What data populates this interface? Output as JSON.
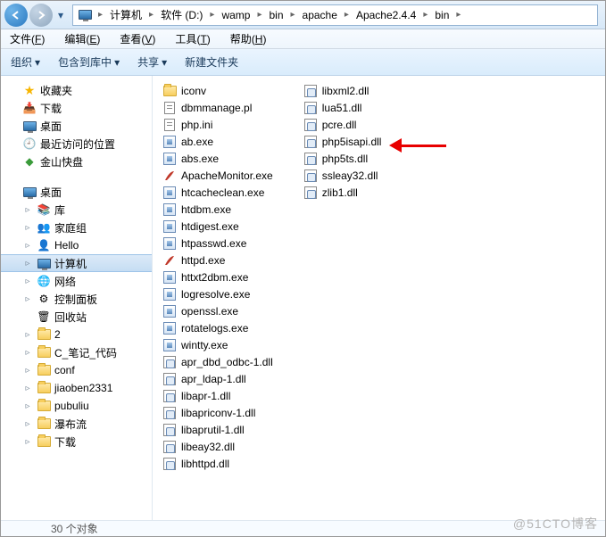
{
  "breadcrumb": {
    "items": [
      "计算机",
      "软件 (D:)",
      "wamp",
      "bin",
      "apache",
      "Apache2.4.4",
      "bin"
    ]
  },
  "menus": {
    "file": "文件",
    "fk": "F",
    "edit": "编辑",
    "ek": "E",
    "view": "查看",
    "vk": "V",
    "tools": "工具",
    "tk": "T",
    "help": "帮助",
    "hk": "H"
  },
  "toolbar": {
    "organize": "组织",
    "include": "包含到库中",
    "share": "共享",
    "newfolder": "新建文件夹"
  },
  "sidebar": {
    "fav": "收藏夹",
    "fav_items": [
      "下载",
      "桌面",
      "最近访问的位置",
      "金山快盘"
    ],
    "desktop": "桌面",
    "desktop_items": [
      "库",
      "家庭组",
      "Hello",
      "计算机",
      "网络",
      "控制面板",
      "回收站",
      "2",
      "C_笔记_代码",
      "conf",
      "jiaoben2331",
      "pubuliu",
      "瀑布流",
      "下载"
    ]
  },
  "files_col1": [
    {
      "n": "iconv",
      "t": "folder"
    },
    {
      "n": "dbmmanage.pl",
      "t": "ini"
    },
    {
      "n": "php.ini",
      "t": "ini"
    },
    {
      "n": "ab.exe",
      "t": "exe"
    },
    {
      "n": "abs.exe",
      "t": "exe"
    },
    {
      "n": "ApacheMonitor.exe",
      "t": "feather"
    },
    {
      "n": "htcacheclean.exe",
      "t": "exe"
    },
    {
      "n": "htdbm.exe",
      "t": "exe"
    },
    {
      "n": "htdigest.exe",
      "t": "exe"
    },
    {
      "n": "htpasswd.exe",
      "t": "exe"
    },
    {
      "n": "httpd.exe",
      "t": "feather"
    },
    {
      "n": "httxt2dbm.exe",
      "t": "exe"
    },
    {
      "n": "logresolve.exe",
      "t": "exe"
    },
    {
      "n": "openssl.exe",
      "t": "exe"
    },
    {
      "n": "rotatelogs.exe",
      "t": "exe"
    },
    {
      "n": "wintty.exe",
      "t": "exe"
    },
    {
      "n": "apr_dbd_odbc-1.dll",
      "t": "dll"
    },
    {
      "n": "apr_ldap-1.dll",
      "t": "dll"
    },
    {
      "n": "libapr-1.dll",
      "t": "dll"
    },
    {
      "n": "libapriconv-1.dll",
      "t": "dll"
    },
    {
      "n": "libaprutil-1.dll",
      "t": "dll"
    },
    {
      "n": "libeay32.dll",
      "t": "dll"
    },
    {
      "n": "libhttpd.dll",
      "t": "dll"
    }
  ],
  "files_col2": [
    {
      "n": "libxml2.dll",
      "t": "dll"
    },
    {
      "n": "lua51.dll",
      "t": "dll"
    },
    {
      "n": "pcre.dll",
      "t": "dll"
    },
    {
      "n": "php5isapi.dll",
      "t": "dll"
    },
    {
      "n": "php5ts.dll",
      "t": "dll"
    },
    {
      "n": "ssleay32.dll",
      "t": "dll"
    },
    {
      "n": "zlib1.dll",
      "t": "dll"
    }
  ],
  "status": "30 个对象",
  "watermark": "@51CTO博客"
}
